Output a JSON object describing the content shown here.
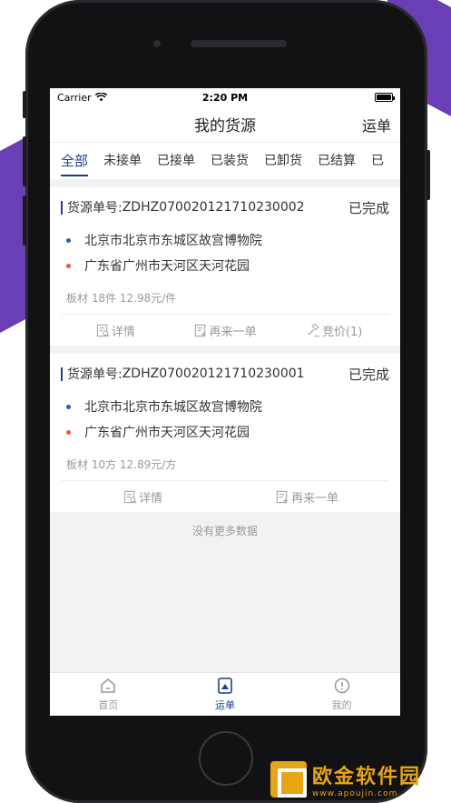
{
  "status_bar": {
    "carrier": "Carrier",
    "time": "2:20 PM"
  },
  "nav": {
    "title": "我的货源",
    "right": "运单"
  },
  "tabs": [
    {
      "label": "全部",
      "active": true
    },
    {
      "label": "未接单"
    },
    {
      "label": "已接单"
    },
    {
      "label": "已装货"
    },
    {
      "label": "已卸货"
    },
    {
      "label": "已结算"
    },
    {
      "label": "已"
    }
  ],
  "orders": [
    {
      "label": "货源单号:",
      "number": "ZDHZ070020121710230002",
      "status": "已完成",
      "origin": "北京市北京市东城区故宫博物院",
      "destination": "广东省广州市天河区天河花园",
      "goods": "板材 18件 12.98元/件",
      "actions": {
        "detail": "详情",
        "reorder": "再来一单",
        "bid": "竞价(1)"
      }
    },
    {
      "label": "货源单号:",
      "number": "ZDHZ070020121710230001",
      "status": "已完成",
      "origin": "北京市北京市东城区故宫博物院",
      "destination": "广东省广州市天河区天河花园",
      "goods": "板材 10方 12.89元/方",
      "actions": {
        "detail": "详情",
        "reorder": "再来一单"
      }
    }
  ],
  "no_more": "没有更多数据",
  "tabbar": {
    "home": "首页",
    "waybill": "运单",
    "mine": "我的"
  },
  "watermark": {
    "title": "欧金软件园",
    "url": "www.apoujin.com"
  },
  "colors": {
    "accent": "#1e3f8a",
    "origin_dot": "#2b5cb8",
    "destination_dot": "#e65a3a",
    "purple": "#6a3fb5",
    "watermark": "#e6a417"
  }
}
